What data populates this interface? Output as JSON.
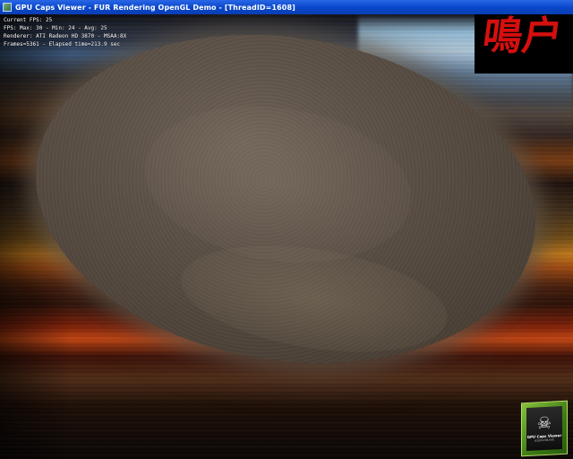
{
  "window": {
    "title": "GPU Caps Viewer - FUR Rendering OpenGL Demo - [ThreadID=1608]",
    "icon": "app-icon"
  },
  "hud": {
    "lines": [
      "Current FPS: 25",
      "FPS: Max: 30 - Min: 24 - Avg: 25",
      "Renderer: ATI Radeon HD 3870 - MSAA:8X",
      "Frames=5361 - Elapsed time=213.9 sec"
    ]
  },
  "watermark": {
    "characters": "鳴户",
    "color": "#d60f0f"
  },
  "badge": {
    "icon": "skull-icon",
    "title": "GPU Caps Viewer",
    "subtitle": "ozone3d.net"
  }
}
